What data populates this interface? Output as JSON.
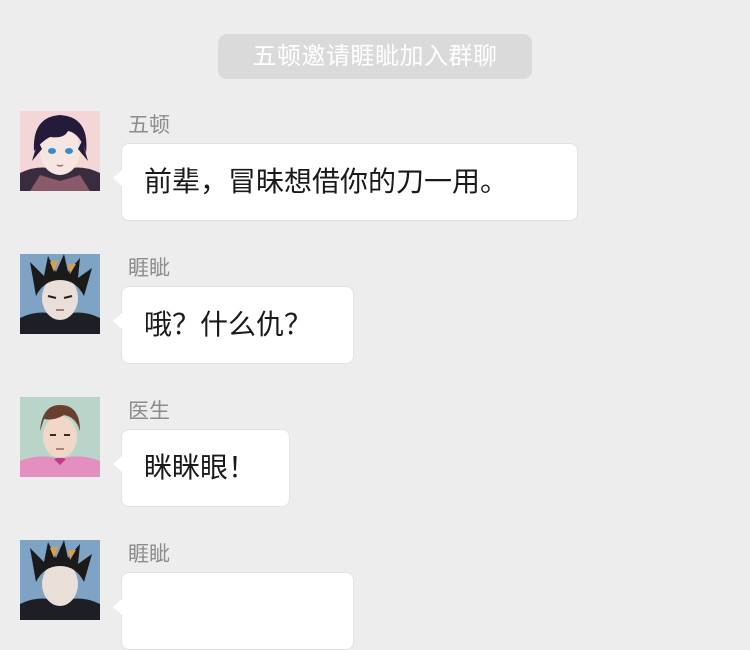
{
  "system_notice": "五顿邀请睚眦加入群聊",
  "messages": [
    {
      "sender": "五顿",
      "text": "前辈，冒昧想借你的刀一用。",
      "avatar": "avatar-wudun"
    },
    {
      "sender": "睚眦",
      "text": "哦？什么仇？",
      "avatar": "avatar-yazi"
    },
    {
      "sender": "医生",
      "text": "眯眯眼！",
      "avatar": "avatar-doctor"
    },
    {
      "sender": "睚眦",
      "text": "",
      "avatar": "avatar-yazi"
    }
  ],
  "colors": {
    "background": "#ededed",
    "notice_bg": "#dadada",
    "bubble_bg": "#ffffff",
    "sender_text": "#8c8c8c"
  }
}
